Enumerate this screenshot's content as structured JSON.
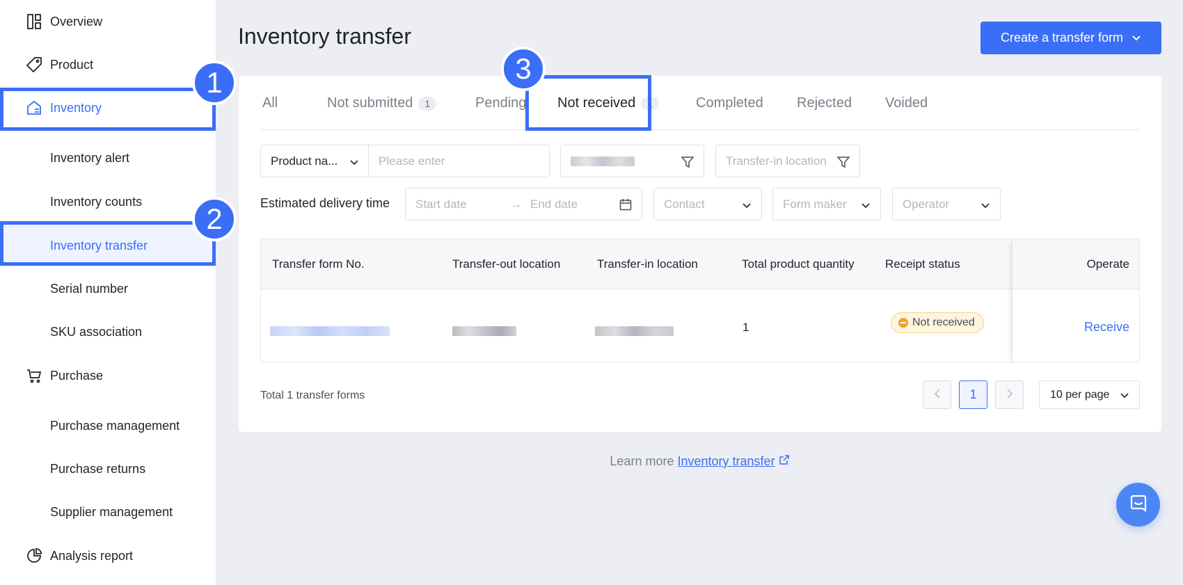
{
  "sidebar": {
    "items": [
      {
        "label": "Overview",
        "icon": "layout-icon"
      },
      {
        "label": "Product",
        "icon": "tag-icon"
      },
      {
        "label": "Inventory",
        "icon": "home-icon"
      },
      {
        "label": "Inventory alert"
      },
      {
        "label": "Inventory counts"
      },
      {
        "label": "Inventory transfer"
      },
      {
        "label": "Serial number"
      },
      {
        "label": "SKU association"
      },
      {
        "label": "Purchase",
        "icon": "cart-icon"
      },
      {
        "label": "Purchase management"
      },
      {
        "label": "Purchase returns"
      },
      {
        "label": "Supplier management"
      },
      {
        "label": "Analysis report",
        "icon": "pie-chart-icon"
      }
    ]
  },
  "steps": [
    "1",
    "2",
    "3"
  ],
  "header": {
    "title": "Inventory transfer",
    "create_button": "Create a transfer form"
  },
  "tabs": [
    {
      "label": "All"
    },
    {
      "label": "Not submitted",
      "count": "1"
    },
    {
      "label": "Pending"
    },
    {
      "label": "Not received",
      "count": "1"
    },
    {
      "label": "Completed"
    },
    {
      "label": "Rejected"
    },
    {
      "label": "Voided"
    }
  ],
  "filters": {
    "search_field": "Product na...",
    "search_placeholder": "Please enter",
    "transfer_in_placeholder": "Transfer-in location",
    "delivery_label": "Estimated delivery time",
    "start_placeholder": "Start date",
    "end_placeholder": "End date",
    "range_arrow": "→",
    "contact_placeholder": "Contact",
    "form_maker_placeholder": "Form maker",
    "operator_placeholder": "Operator"
  },
  "table": {
    "columns": [
      "Transfer form No.",
      "Transfer-out location",
      "Transfer-in location",
      "Total product quantity",
      "Receipt status",
      "Operate"
    ],
    "rows": [
      {
        "quantity": "1",
        "status": "Not received",
        "action": "Receive"
      }
    ]
  },
  "footer": {
    "total": "Total 1 transfer forms",
    "current_page": "1",
    "page_size": "10 per page"
  },
  "learn_more": {
    "prefix": "Learn more",
    "link": "Inventory transfer"
  },
  "colors": {
    "accent": "#3b6ef6",
    "status_warning": "#f0a22e"
  }
}
